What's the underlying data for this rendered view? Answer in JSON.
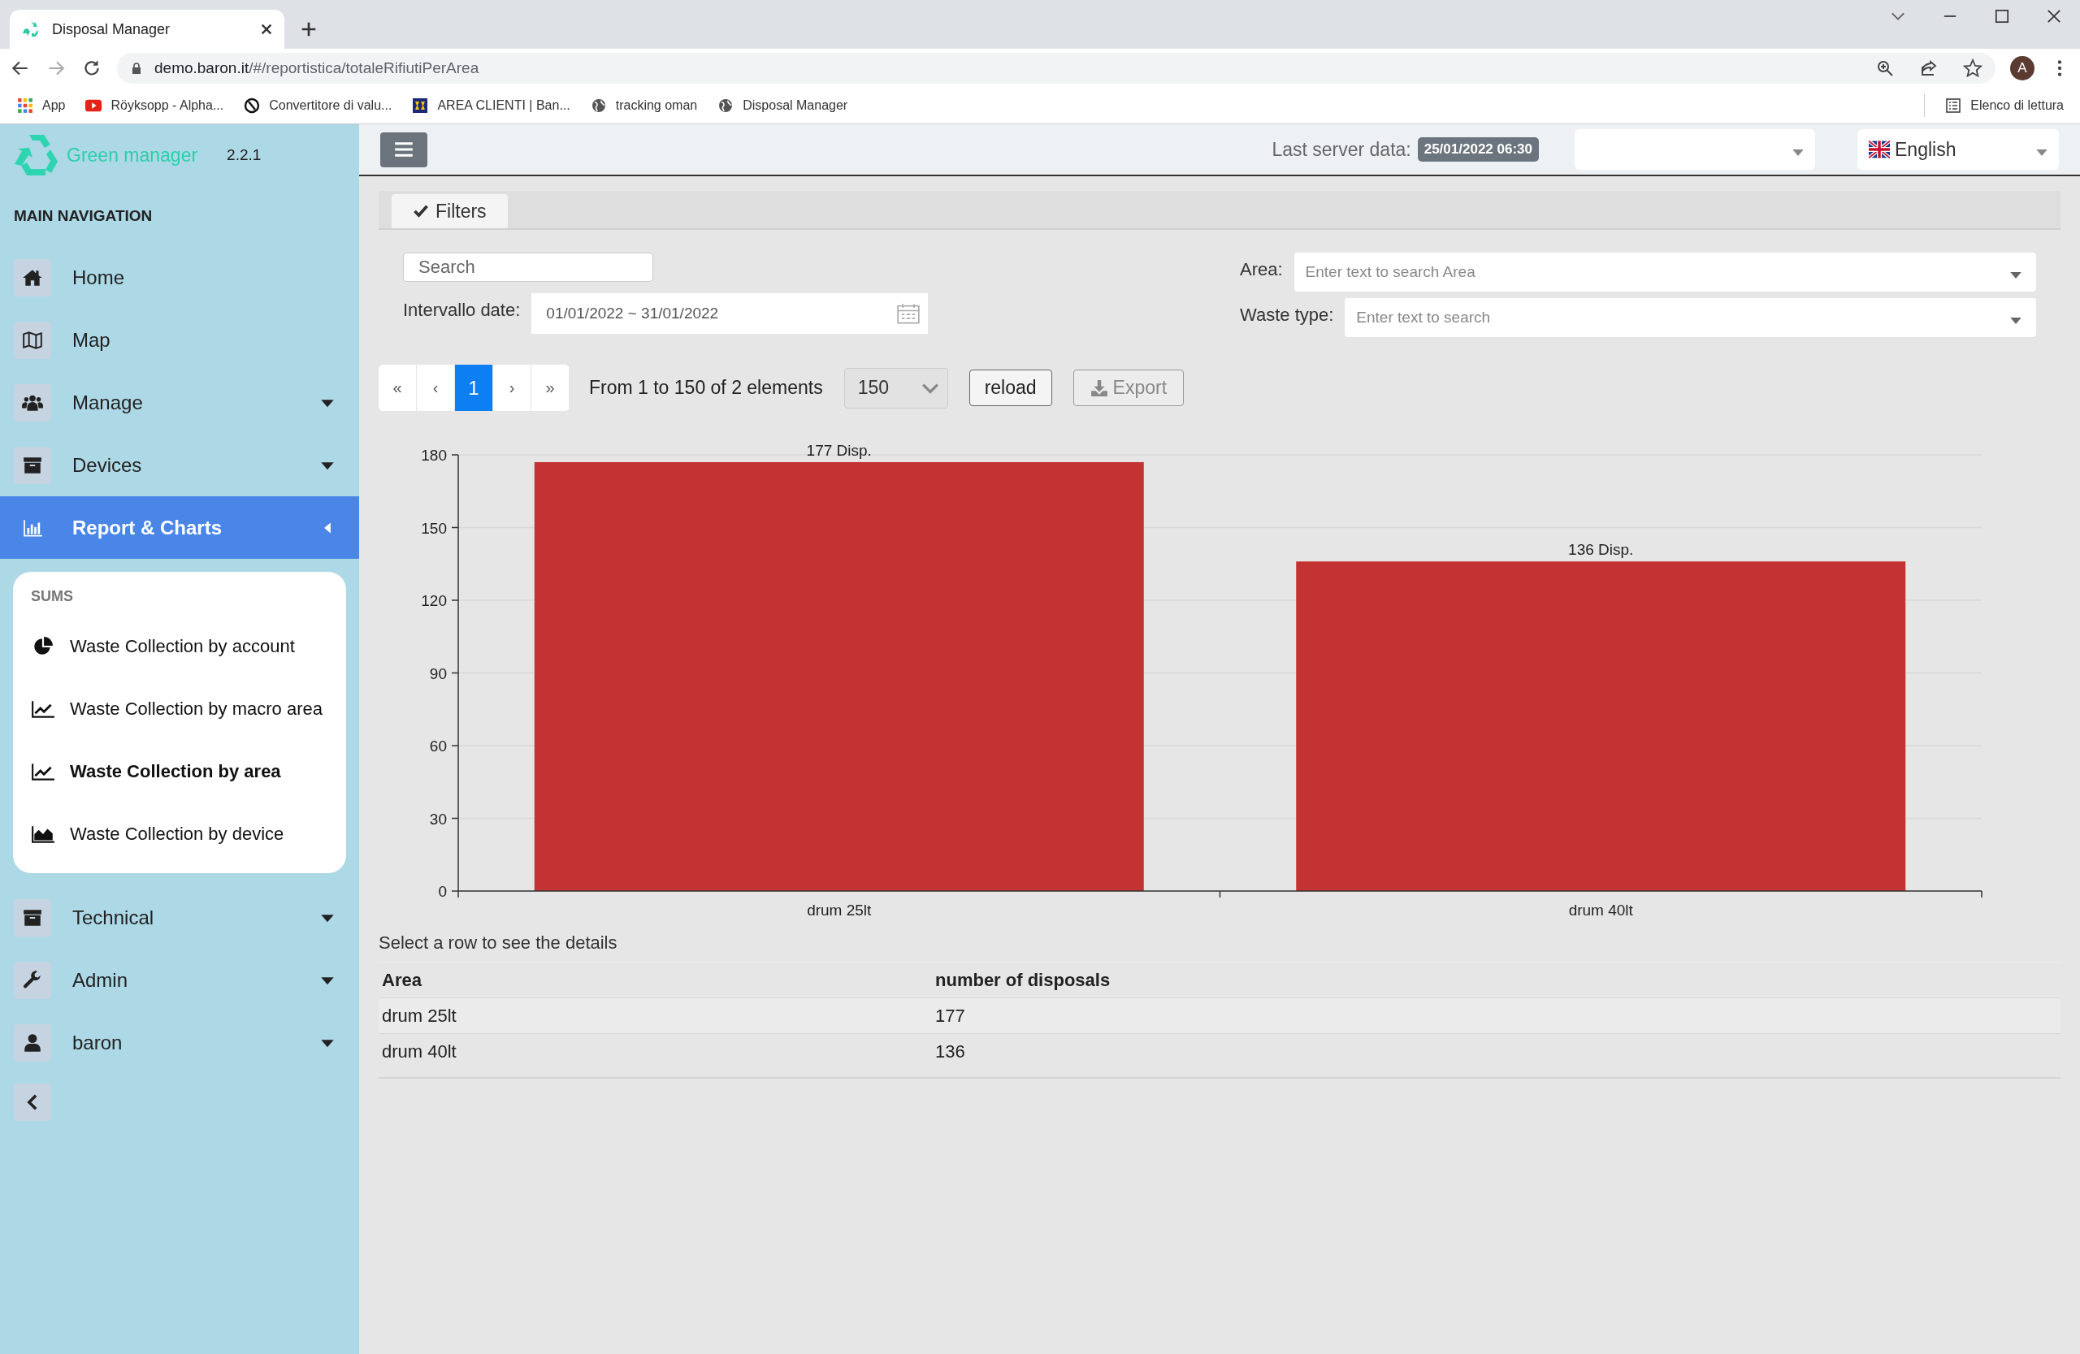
{
  "browser": {
    "tab_title": "Disposal Manager",
    "url_host": "demo.baron.it",
    "url_path": "/#/reportistica/totaleRifiutiPerArea",
    "bookmarks": [
      {
        "label": "App"
      },
      {
        "label": "Röyksopp - Alpha..."
      },
      {
        "label": "Convertitore di valu..."
      },
      {
        "label": "AREA CLIENTI | Ban..."
      },
      {
        "label": "tracking oman"
      },
      {
        "label": "Disposal Manager"
      }
    ],
    "reading_list": "Elenco di lettura",
    "profile": "A"
  },
  "sidebar": {
    "brand": "Green manager",
    "version": "2.2.1",
    "header": "MAIN NAVIGATION",
    "items": [
      {
        "label": "Home",
        "selected": false,
        "expandable": false,
        "expanded": false
      },
      {
        "label": "Map",
        "selected": false,
        "expandable": false,
        "expanded": false
      },
      {
        "label": "Manage",
        "selected": false,
        "expandable": true,
        "expanded": false
      },
      {
        "label": "Devices",
        "selected": false,
        "expandable": true,
        "expanded": false
      },
      {
        "label": "Report & Charts",
        "selected": true,
        "expandable": true,
        "expanded": true
      },
      {
        "label": "Technical",
        "selected": false,
        "expandable": true,
        "expanded": false
      },
      {
        "label": "Admin",
        "selected": false,
        "expandable": true,
        "expanded": false
      },
      {
        "label": "baron",
        "selected": false,
        "expandable": true,
        "expanded": false
      }
    ],
    "submenu": {
      "header": "SUMS",
      "items": [
        {
          "label": "Waste Collection by account",
          "selected": false
        },
        {
          "label": "Waste Collection by macro area",
          "selected": false
        },
        {
          "label": "Waste Collection by area",
          "selected": true
        },
        {
          "label": "Waste Collection by device",
          "selected": false
        }
      ]
    }
  },
  "header": {
    "server_label": "Last server data:",
    "server_date": "25/01/2022 06:30",
    "language": "English"
  },
  "filters": {
    "tab": "Filters",
    "search_placeholder": "Search",
    "date_label": "Intervallo date:",
    "date_value": "01/01/2022 ~ 31/01/2022",
    "area_label": "Area:",
    "area_placeholder": "Enter text to search Area",
    "waste_label": "Waste type:",
    "waste_placeholder": "Enter text to search"
  },
  "pagination": {
    "pages": [
      {
        "label": "«",
        "selected": false
      },
      {
        "label": "‹",
        "selected": false
      },
      {
        "label": "1",
        "selected": true
      },
      {
        "label": "›",
        "selected": false
      },
      {
        "label": "»",
        "selected": false
      }
    ],
    "summary": "From 1 to 150 of 2 elements",
    "page_size": "150",
    "reload": "reload",
    "export": "Export"
  },
  "chart": {
    "chart_data": {
      "type": "bar",
      "categories": [
        "drum 25lt",
        "drum 40lt"
      ],
      "series": [
        {
          "color": "#c43333",
          "values": [
            177,
            136
          ]
        }
      ],
      "grid": true,
      "ylim": [
        0,
        180
      ],
      "yticks": [
        0,
        30,
        60,
        90,
        120,
        150,
        180
      ],
      "value_labels": [
        "177 Disp.",
        "136 Disp."
      ]
    }
  },
  "table": {
    "caption": "Select a row to see the details",
    "columns": [
      "Area",
      "number of disposals"
    ],
    "rows": [
      [
        "drum 25lt",
        "177"
      ],
      [
        "drum 40lt",
        "136"
      ]
    ]
  }
}
